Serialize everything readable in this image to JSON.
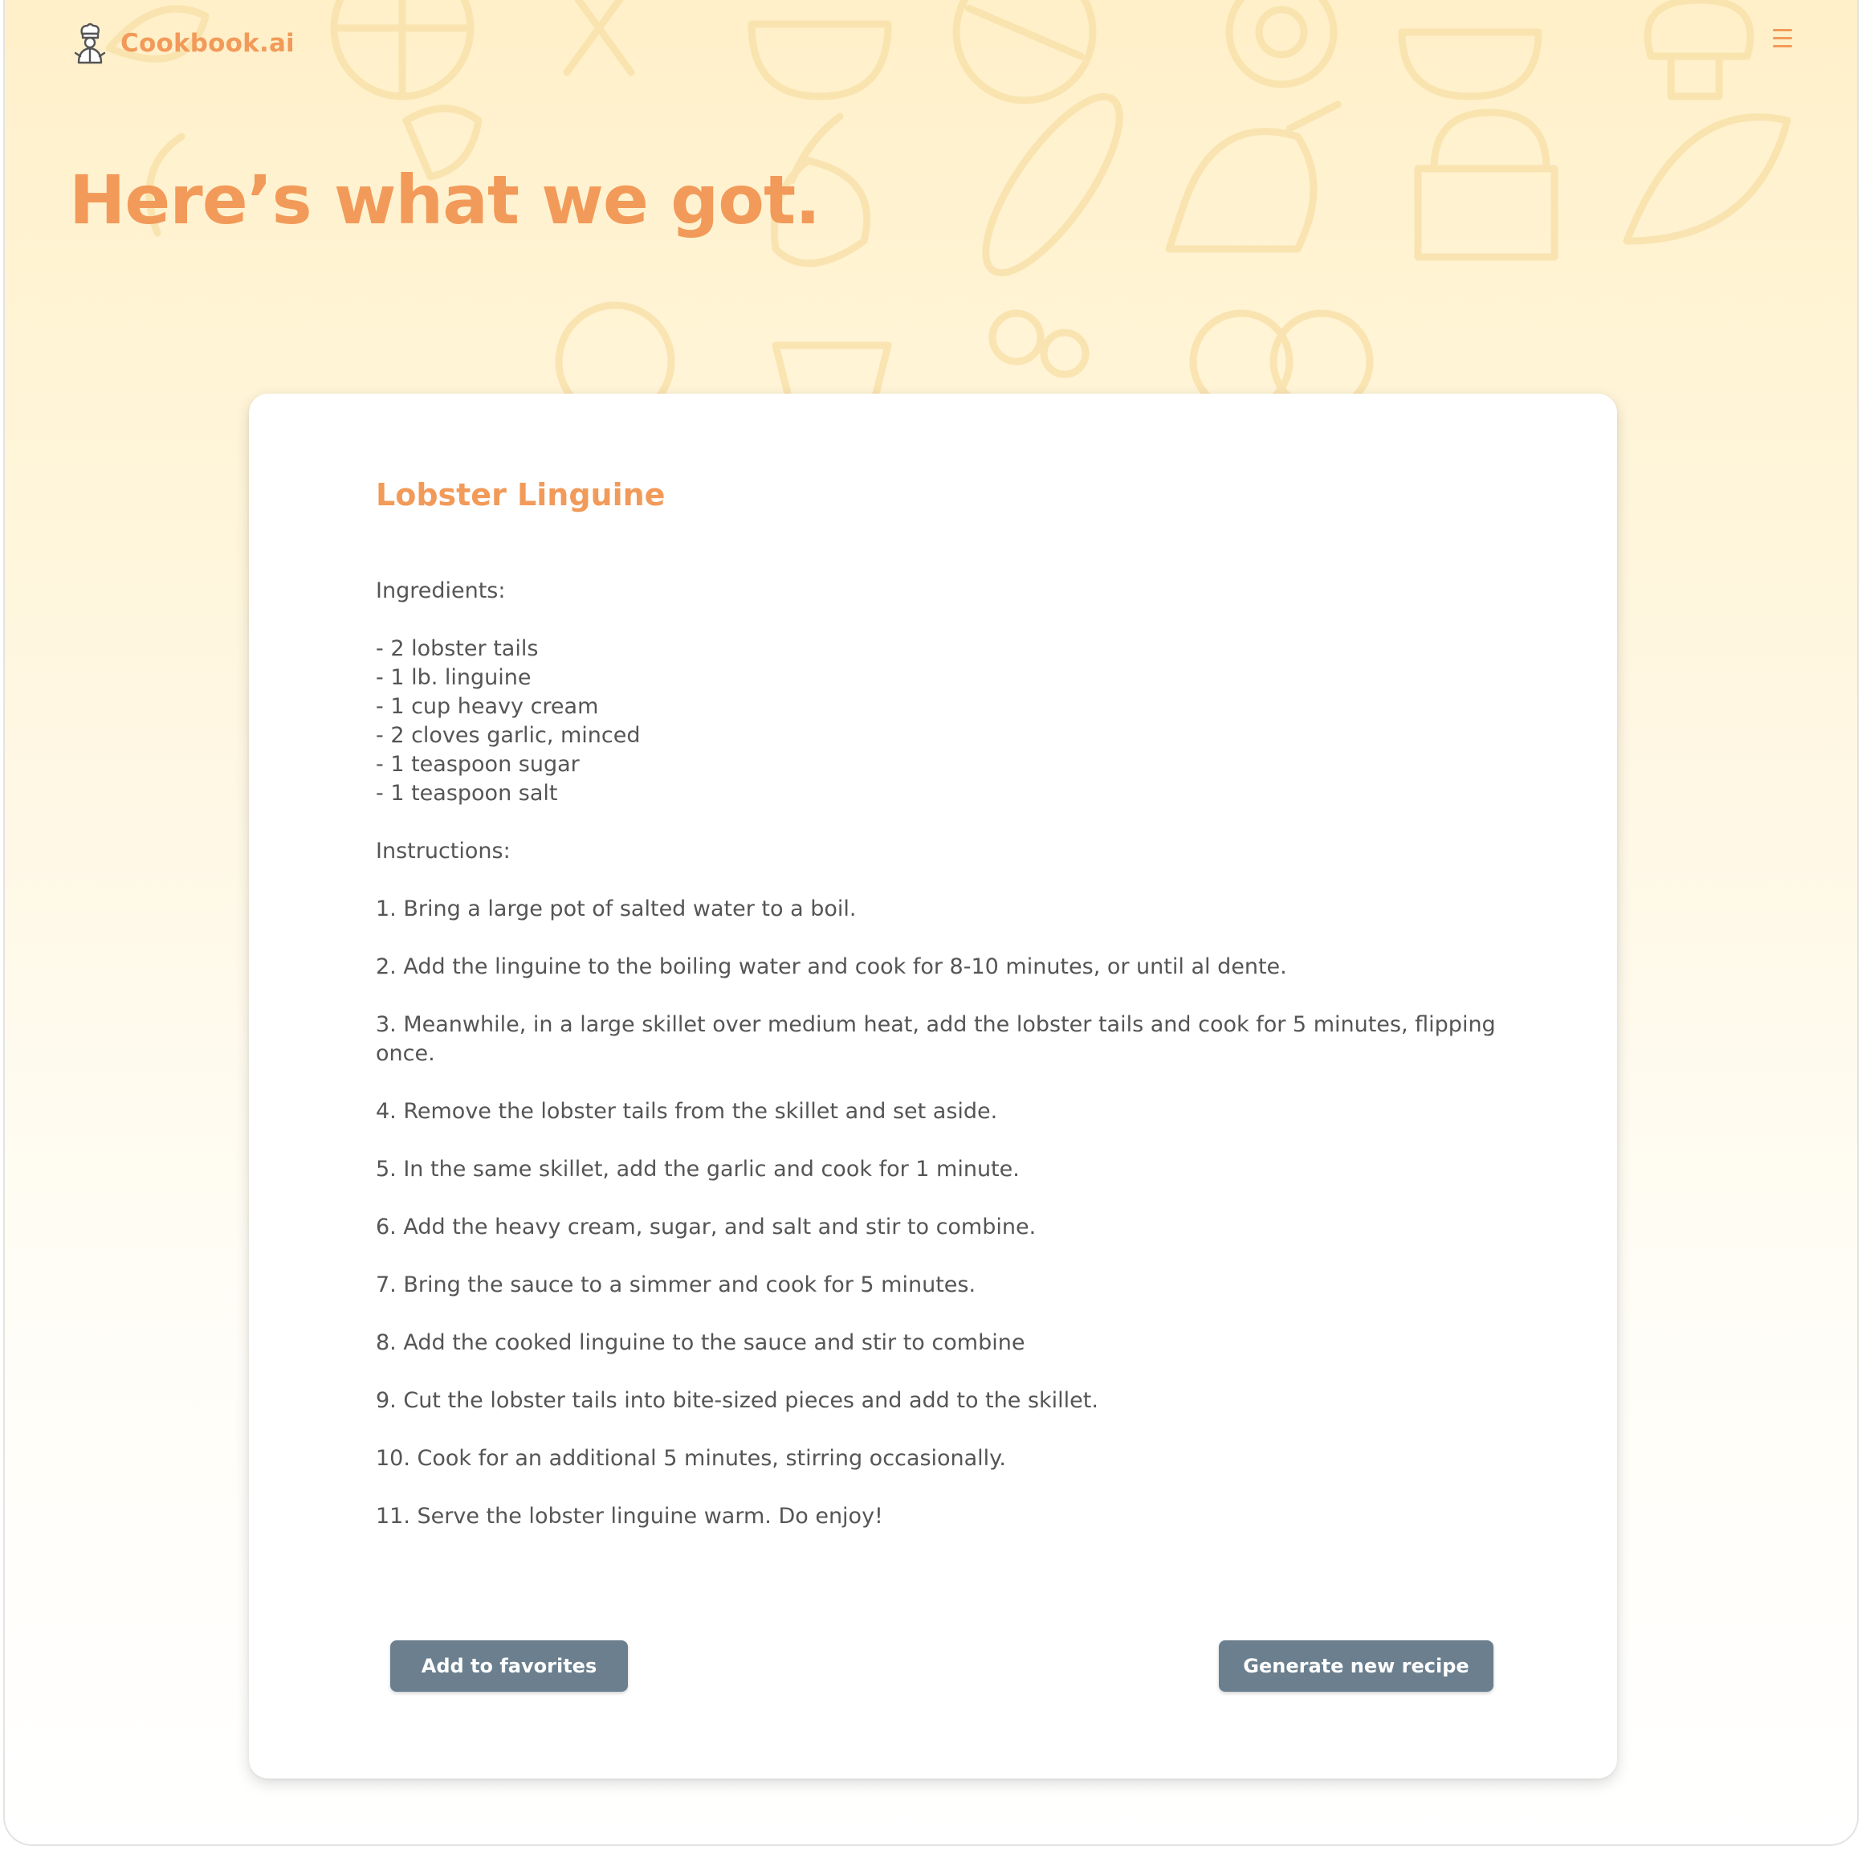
{
  "brand": {
    "name": "Cookbook.ai",
    "icon": "chef-icon"
  },
  "menu": {
    "icon": "hamburger-menu-icon"
  },
  "hero": {
    "title": "Here’s what we got."
  },
  "recipe": {
    "title": "Lobster Linguine",
    "ingredients_label": "Ingredients:",
    "ingredients": [
      "- 2 lobster tails",
      "- 1 lb. linguine",
      "- 1 cup heavy cream",
      "- 2 cloves garlic, minced",
      "- 1 teaspoon sugar",
      "- 1 teaspoon salt"
    ],
    "instructions_label": "Instructions:",
    "steps": [
      "1. Bring a large pot of salted water to a boil.",
      "2. Add the linguine to the boiling water and cook for 8-10 minutes, or until al dente.",
      "3. Meanwhile, in a large skillet over medium heat, add the lobster tails and cook for 5 minutes, flipping once.",
      "4. Remove the lobster tails from the skillet and set aside.",
      "5. In the same skillet, add the garlic and cook for 1 minute.",
      "6. Add the heavy cream, sugar, and salt and stir to combine.",
      "7. Bring the sauce to a simmer and cook for 5 minutes.",
      "8. Add the cooked linguine to the sauce and stir to combine",
      "9. Cut the lobster tails into bite-sized pieces and add to the skillet.",
      "10. Cook for an additional 5 minutes, stirring occasionally.",
      "11. Serve the lobster linguine warm. Do enjoy!"
    ]
  },
  "actions": {
    "add_favorites_label": "Add to favorites",
    "generate_label": "Generate new recipe"
  },
  "colors": {
    "accent": "#f29a59",
    "button": "#6b7f8e",
    "body_text": "#555555"
  }
}
